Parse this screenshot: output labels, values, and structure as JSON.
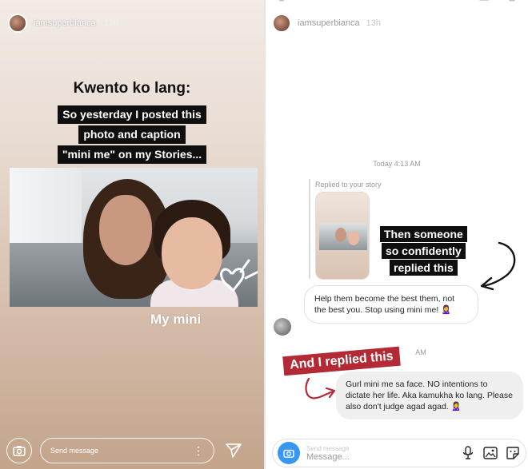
{
  "story": {
    "username": "iamsuperbianca",
    "time": "13h",
    "heading": "Kwento ko lang:",
    "caption_lines": [
      "So yesterday I posted this",
      "photo and caption",
      "\"mini me\" on my Stories..."
    ],
    "photo_sticker": "My mini",
    "footer": {
      "message_placeholder": "Send message"
    }
  },
  "dm": {
    "username": "iamsuperbianca",
    "time": "13h",
    "timestamp": "Today 4:13 AM",
    "timestamp2": "AM",
    "replied_label": "Replied to your story",
    "sticker_lines": [
      "Then someone",
      "so confidently",
      "replied this"
    ],
    "incoming_message": "Help them become the best them, not the best you. Stop using mini me! 🙎‍♀️",
    "red_label": "And I replied this",
    "outgoing_message": "Gurl mini me sa face. NO intentions to dictate her life. Aka kamukha ko lang. Please also don't judge agad agad. 🙎‍♀️",
    "composer": {
      "faint_text": "Send message",
      "placeholder": "Message..."
    }
  },
  "colors": {
    "ig_blue": "#3897f0",
    "red_label": "#b12a35",
    "sticker_black": "#0f0f0f",
    "bubble_gray": "#efefef"
  },
  "icons": [
    "camera-icon",
    "more-dots-icon",
    "send-icon",
    "microphone-icon",
    "gallery-icon",
    "sticker-icon"
  ]
}
